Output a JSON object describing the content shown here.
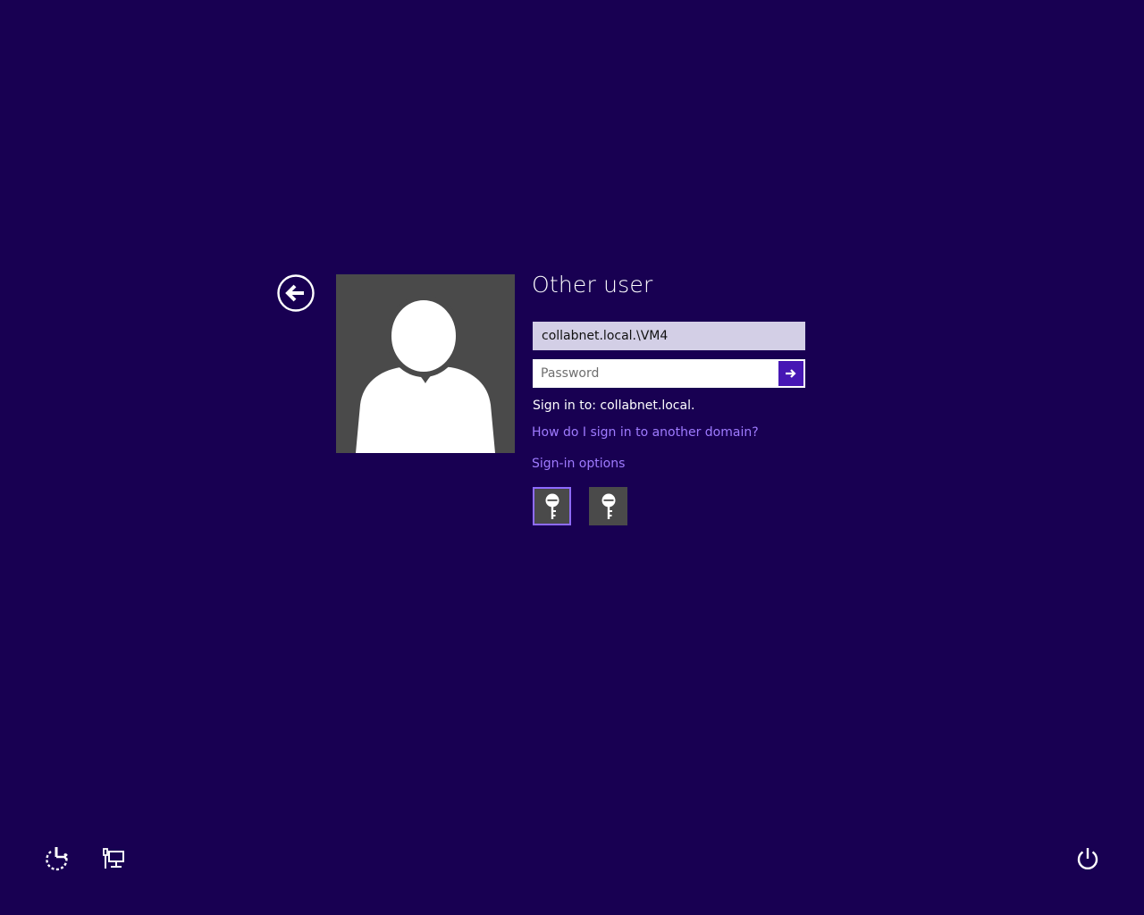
{
  "login": {
    "title": "Other user",
    "username_value": "collabnet.local.\\VM4",
    "password_placeholder": "Password",
    "sign_in_to": "Sign in to: collabnet.local.",
    "help_link": "How do I sign in to another domain?",
    "sign_in_options": "Sign-in options"
  },
  "icons": {
    "back": "back-arrow-circle-icon",
    "avatar": "user-silhouette-icon",
    "submit": "arrow-right-icon",
    "option_1": "key-icon",
    "option_2": "key-icon",
    "ease_of_access": "ease-of-access-icon",
    "network": "network-icon",
    "power": "power-icon"
  },
  "colors": {
    "background": "#180052",
    "accent": "#4617b4",
    "link": "#9f7bff",
    "avatar_tile": "#4a4a4a",
    "selected_border": "#8e6bff"
  }
}
